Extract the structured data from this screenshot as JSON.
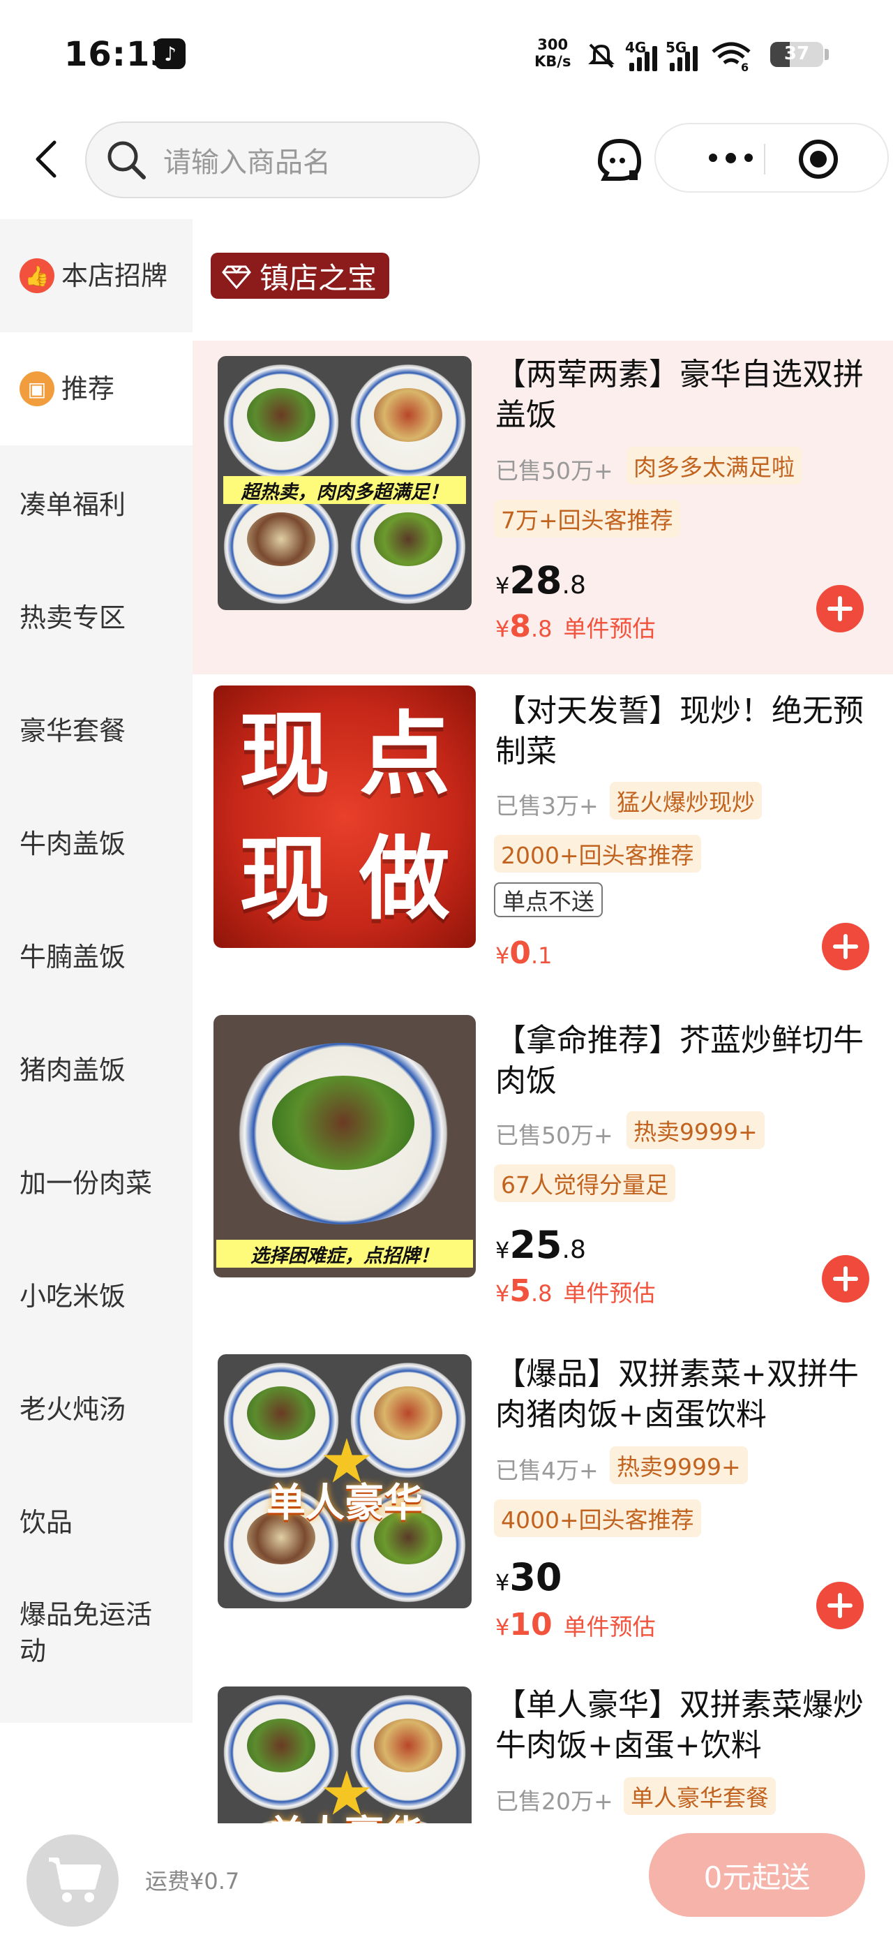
{
  "status_bar": {
    "time": "16:13",
    "net_speed_top": "300",
    "net_speed_bottom": "KB/s",
    "sig1": "4G",
    "sig2": "5G",
    "wifi_badge": "6",
    "battery": "37"
  },
  "header": {
    "search_placeholder": "请输入商品名"
  },
  "sidebar": {
    "items": [
      {
        "label": "本店招牌",
        "icon": "thumbs-up-icon",
        "active": false
      },
      {
        "label": "推荐",
        "icon": "recommend-icon",
        "active": true
      },
      {
        "label": "凑单福利",
        "active": false
      },
      {
        "label": "热卖专区",
        "active": false
      },
      {
        "label": "豪华套餐",
        "active": false
      },
      {
        "label": "牛肉盖饭",
        "active": false
      },
      {
        "label": "牛腩盖饭",
        "active": false
      },
      {
        "label": "猪肉盖饭",
        "active": false
      },
      {
        "label": "加一份肉菜",
        "active": false
      },
      {
        "label": "小吃米饭",
        "active": false
      },
      {
        "label": "老火炖汤",
        "active": false
      },
      {
        "label": "饮品",
        "active": false
      },
      {
        "label": "爆品免运活动",
        "active": false
      }
    ]
  },
  "section": {
    "title": "镇店之宝"
  },
  "products": [
    {
      "title": "【两荤两素】豪华自选双拼盖饭",
      "sold": "已售50万+",
      "tags": [
        "肉多多太满足啦",
        "7万+回头客推荐"
      ],
      "price_symbol": "¥",
      "price_int": "28",
      "price_dec": ".8",
      "est_symbol": "¥",
      "est_int": "8",
      "est_dec": ".8",
      "est_label": "单件预估",
      "image_banner": "超热卖，肉肉多超满足！"
    },
    {
      "title": "【对天发誓】现炒！绝无预制菜",
      "sold": "已售3万+",
      "tags": [
        "猛火爆炒现炒",
        "2000+回头客推荐"
      ],
      "notice": "单点不送",
      "est_symbol": "¥",
      "est_int": "0",
      "est_dec": ".1",
      "image_chars": [
        "现",
        "点",
        "现",
        "做"
      ]
    },
    {
      "title": "【拿命推荐】芥蓝炒鲜切牛肉饭",
      "sold": "已售50万+",
      "tags": [
        "热卖9999+",
        "67人觉得分量足"
      ],
      "price_symbol": "¥",
      "price_int": "25",
      "price_dec": ".8",
      "est_symbol": "¥",
      "est_int": "5",
      "est_dec": ".8",
      "est_label": "单件预估",
      "image_banner": "选择困难症，点招牌！"
    },
    {
      "title": "【爆品】双拼素菜+双拼牛肉猪肉饭+卤蛋饮料",
      "sold": "已售4万+",
      "tags": [
        "热卖9999+",
        "4000+回头客推荐"
      ],
      "price_symbol": "¥",
      "price_int": "30",
      "price_dec": "",
      "est_symbol": "¥",
      "est_int": "10",
      "est_dec": "",
      "est_label": "单件预估",
      "image_text": "单人豪华"
    },
    {
      "title": "【单人豪华】双拼素菜爆炒牛肉饭+卤蛋+饮料",
      "sold": "已售20万+",
      "tags": [
        "单人豪华套餐"
      ],
      "image_text": "单人豪华"
    }
  ],
  "bottom": {
    "fee": "运费¥0.7",
    "submit": "0元起送"
  },
  "colors": {
    "accent": "#ef4a3b",
    "highlight_bg": "#fdeeee",
    "tag_bg": "#fdf1dd",
    "tag_text": "#c1621f",
    "badge_bg": "#8c1c1c",
    "submit_bg": "#f6b3aa"
  }
}
